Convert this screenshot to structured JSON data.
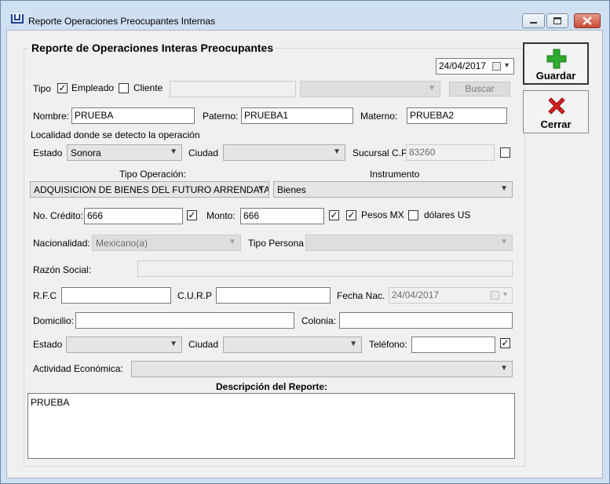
{
  "window": {
    "title": "Reporte Operaciones Preocupantes Internas"
  },
  "form": {
    "group_title": "Reporte de Operaciones Interas Preocupantes",
    "date_top": "24/04/2017",
    "tipo_label": "Tipo",
    "empleado_label": "Empleado",
    "empleado_checked": "✓",
    "cliente_label": "Cliente",
    "cliente_checked": "",
    "buscar_label": "Buscar",
    "nombre_label": "Nombre:",
    "nombre_value": "PRUEBA",
    "paterno_label": "Paterno:",
    "paterno_value": "PRUEBA1",
    "materno_label": "Materno:",
    "materno_value": "PRUEBA2",
    "localidad_label": "Localidad donde se detecto la operación",
    "estado_label": "Estado",
    "estado_value": "Sonora",
    "ciudad_label": "Ciudad",
    "ciudad_value": "",
    "sucursal_label": "Sucursal C.P",
    "sucursal_value": "83260",
    "tipo_operacion_label": "Tipo Operación:",
    "tipo_operacion_value": "ADQUISICION DE BIENES DEL FUTURO ARRENDATAR",
    "instrumento_label": "Instrumento",
    "instrumento_value": "Bienes",
    "credito_label": "No. Crédito:",
    "credito_value": "666",
    "credito_checked": "✓",
    "monto_label": "Monto:",
    "monto_value": "666",
    "monto_checked": "✓",
    "pesos_label": "Pesos MX",
    "pesos_checked": "✓",
    "dolares_label": "dólares US",
    "dolares_checked": "",
    "nacionalidad_label": "Nacionalidad:",
    "nacionalidad_value": "Mexicano(a)",
    "tipo_persona_label": "Tipo Persona",
    "tipo_persona_value": "",
    "razon_social_label": "Razón Social:",
    "razon_social_value": "",
    "rfc_label": "R.F.C",
    "rfc_value": "",
    "curp_label": "C.U.R.P",
    "curp_value": "",
    "fecha_nac_label": "Fecha Nac.",
    "fecha_nac_value": "24/04/2017",
    "domicilio_label": "Domicilio:",
    "domicilio_value": "",
    "colonia_label": "Colonia:",
    "colonia_value": "",
    "estado2_label": "Estado",
    "estado2_value": "",
    "ciudad2_label": "Ciudad",
    "ciudad2_value": "",
    "telefono_label": "Teléfono:",
    "telefono_value": "",
    "telefono_checked": "✓",
    "actividad_label": "Actividad Económica:",
    "actividad_value": "",
    "descripcion_label": "Descripción del Reporte:",
    "descripcion_value": "PRUEBA",
    "sucursal_checked": ""
  },
  "actions": {
    "guardar_label": "Guardar",
    "cerrar_label": "Cerrar"
  },
  "colors": {
    "guardar_icon": "#2eaa2e",
    "cerrar_icon": "#d42020"
  }
}
